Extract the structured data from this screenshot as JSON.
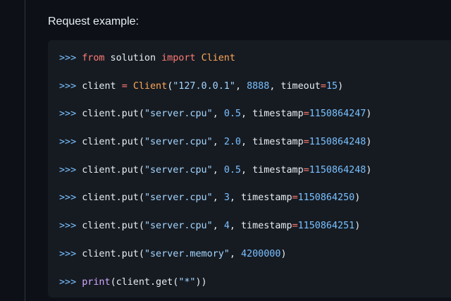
{
  "heading": "Request example:",
  "code": {
    "language": "python-repl",
    "lines": [
      [
        {
          "t": ">>> ",
          "k": "prompt"
        },
        {
          "t": "from",
          "k": "kw"
        },
        {
          "t": " solution ",
          "k": "plain"
        },
        {
          "t": "import",
          "k": "kw"
        },
        {
          "t": " ",
          "k": "plain"
        },
        {
          "t": "Client",
          "k": "cls"
        }
      ],
      [
        {
          "t": ">>> ",
          "k": "prompt"
        },
        {
          "t": "client ",
          "k": "plain"
        },
        {
          "t": "=",
          "k": "op"
        },
        {
          "t": " ",
          "k": "plain"
        },
        {
          "t": "Client",
          "k": "cls"
        },
        {
          "t": "(",
          "k": "plain"
        },
        {
          "t": "\"127.0.0.1\"",
          "k": "str"
        },
        {
          "t": ", ",
          "k": "plain"
        },
        {
          "t": "8888",
          "k": "num"
        },
        {
          "t": ", timeout",
          "k": "plain"
        },
        {
          "t": "=",
          "k": "op"
        },
        {
          "t": "15",
          "k": "num"
        },
        {
          "t": ")",
          "k": "plain"
        }
      ],
      [
        {
          "t": ">>> ",
          "k": "prompt"
        },
        {
          "t": "client.put(",
          "k": "plain"
        },
        {
          "t": "\"server.cpu\"",
          "k": "str"
        },
        {
          "t": ", ",
          "k": "plain"
        },
        {
          "t": "0.5",
          "k": "num"
        },
        {
          "t": ", timestamp",
          "k": "plain"
        },
        {
          "t": "=",
          "k": "op"
        },
        {
          "t": "1150864247",
          "k": "num"
        },
        {
          "t": ")",
          "k": "plain"
        }
      ],
      [
        {
          "t": ">>> ",
          "k": "prompt"
        },
        {
          "t": "client.put(",
          "k": "plain"
        },
        {
          "t": "\"server.cpu\"",
          "k": "str"
        },
        {
          "t": ", ",
          "k": "plain"
        },
        {
          "t": "2.0",
          "k": "num"
        },
        {
          "t": ", timestamp",
          "k": "plain"
        },
        {
          "t": "=",
          "k": "op"
        },
        {
          "t": "1150864248",
          "k": "num"
        },
        {
          "t": ")",
          "k": "plain"
        }
      ],
      [
        {
          "t": ">>> ",
          "k": "prompt"
        },
        {
          "t": "client.put(",
          "k": "plain"
        },
        {
          "t": "\"server.cpu\"",
          "k": "str"
        },
        {
          "t": ", ",
          "k": "plain"
        },
        {
          "t": "0.5",
          "k": "num"
        },
        {
          "t": ", timestamp",
          "k": "plain"
        },
        {
          "t": "=",
          "k": "op"
        },
        {
          "t": "1150864248",
          "k": "num"
        },
        {
          "t": ")",
          "k": "plain"
        }
      ],
      [
        {
          "t": ">>> ",
          "k": "prompt"
        },
        {
          "t": "client.put(",
          "k": "plain"
        },
        {
          "t": "\"server.cpu\"",
          "k": "str"
        },
        {
          "t": ", ",
          "k": "plain"
        },
        {
          "t": "3",
          "k": "num"
        },
        {
          "t": ", timestamp",
          "k": "plain"
        },
        {
          "t": "=",
          "k": "op"
        },
        {
          "t": "1150864250",
          "k": "num"
        },
        {
          "t": ")",
          "k": "plain"
        }
      ],
      [
        {
          "t": ">>> ",
          "k": "prompt"
        },
        {
          "t": "client.put(",
          "k": "plain"
        },
        {
          "t": "\"server.cpu\"",
          "k": "str"
        },
        {
          "t": ", ",
          "k": "plain"
        },
        {
          "t": "4",
          "k": "num"
        },
        {
          "t": ", timestamp",
          "k": "plain"
        },
        {
          "t": "=",
          "k": "op"
        },
        {
          "t": "1150864251",
          "k": "num"
        },
        {
          "t": ")",
          "k": "plain"
        }
      ],
      [
        {
          "t": ">>> ",
          "k": "prompt"
        },
        {
          "t": "client.put(",
          "k": "plain"
        },
        {
          "t": "\"server.memory\"",
          "k": "str"
        },
        {
          "t": ", ",
          "k": "plain"
        },
        {
          "t": "4200000",
          "k": "num"
        },
        {
          "t": ")",
          "k": "plain"
        }
      ],
      [
        {
          "t": ">>> ",
          "k": "prompt"
        },
        {
          "t": "print",
          "k": "builtin"
        },
        {
          "t": "(client.get(",
          "k": "plain"
        },
        {
          "t": "\"*\"",
          "k": "str"
        },
        {
          "t": "))",
          "k": "plain"
        }
      ]
    ]
  },
  "colors": {
    "page_background": "#0d1117",
    "code_background": "#161b22",
    "prompt": "#79c0ff",
    "keyword": "#ff7b72",
    "class_name": "#ffa657",
    "string": "#a5d6ff",
    "number": "#79c0ff",
    "builtin": "#d2a8ff",
    "text": "#e6edf3"
  }
}
